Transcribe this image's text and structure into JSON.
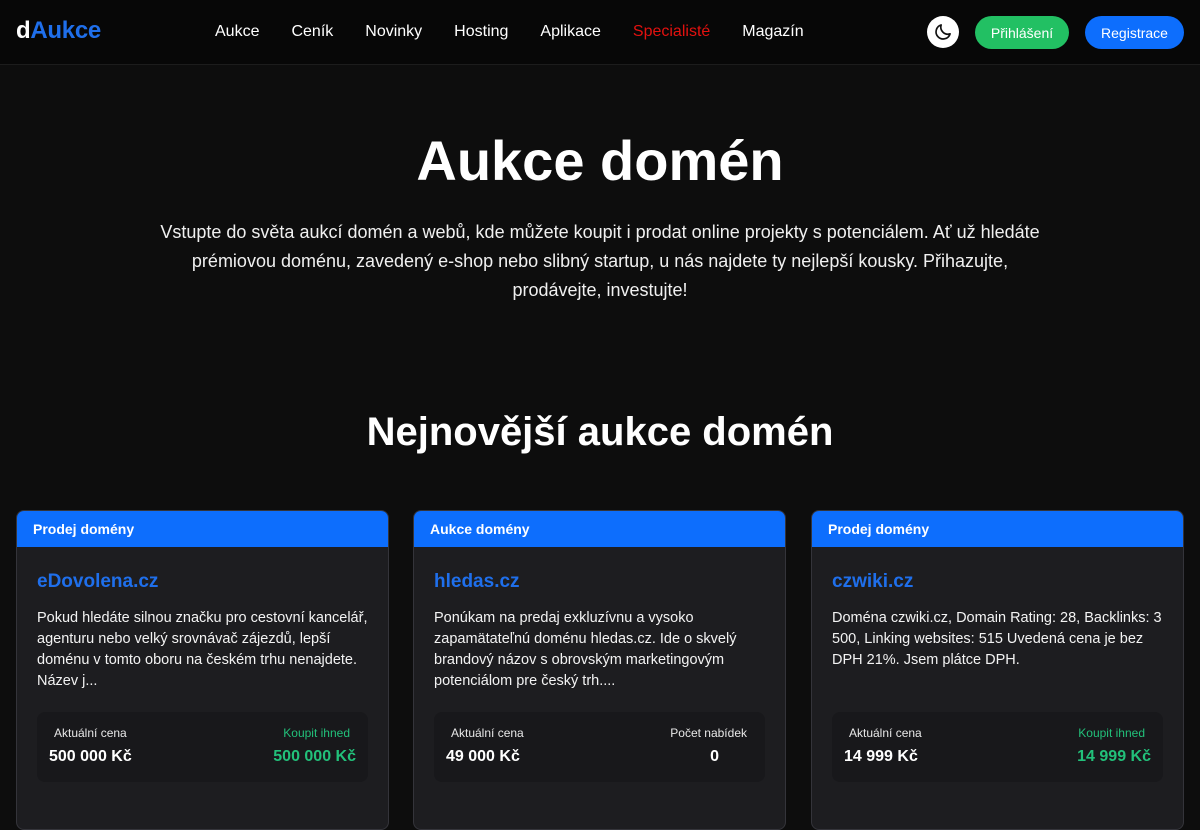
{
  "brand": {
    "part1": "d",
    "part2": "Aukce"
  },
  "nav": {
    "items": [
      {
        "label": "Aukce"
      },
      {
        "label": "Ceník"
      },
      {
        "label": "Novinky"
      },
      {
        "label": "Hosting"
      },
      {
        "label": "Aplikace"
      },
      {
        "label": "Specialisté"
      },
      {
        "label": "Magazín"
      }
    ],
    "active_index": 5,
    "login_label": "Přihlášení",
    "register_label": "Registrace",
    "theme_icon": "moon-icon"
  },
  "hero": {
    "title": "Aukce domén",
    "text": "Vstupte do světa aukcí domén a webů, kde můžete koupit i prodat online projekty s potenciálem. Ať už hledáte prémiovou doménu, zavedený e-shop nebo slibný startup, u nás najdete ty nejlepší kousky. Přihazujte, prodávejte, investujte!"
  },
  "section": {
    "title": "Nejnovější aukce domén"
  },
  "cards": [
    {
      "category": "Prodej domény",
      "domain": "eDovolena.cz",
      "description": "Pokud hledáte silnou značku pro cestovní kancelář, agenturu nebo velký srovnávač zájezdů, lepší doménu v tomto oboru na českém trhu nenajdete. Název j...",
      "left_label": "Aktuální cena",
      "left_value": "500 000 Kč",
      "right_label": "Koupit ihned",
      "right_value": "500 000 Kč"
    },
    {
      "category": "Aukce domény",
      "domain": "hledas.cz",
      "description": "Ponúkam na predaj exkluzívnu a vysoko zapamätateľnú doménu hledas.cz. Ide o skvelý brandový názov s obrovským marketingovým potenciálom pre český trh....",
      "left_label": "Aktuální cena",
      "left_value": "49 000 Kč",
      "right_label": "Počet nabídek",
      "right_value": "0"
    },
    {
      "category": "Prodej domény",
      "domain": "czwiki.cz",
      "description": "Doména czwiki.cz, Domain Rating: 28, Backlinks: 3 500, Linking websites: 515 Uvedená cena je bez DPH 21%. Jsem plátce DPH.",
      "left_label": "Aktuální cena",
      "left_value": "14 999 Kč",
      "right_label": "Koupit ihned",
      "right_value": "14 999 Kč"
    }
  ],
  "colors": {
    "accent_blue": "#0d6efd",
    "accent_green": "#22c063",
    "price_green": "#22c07a",
    "active_red": "#e3110f",
    "background": "#0d0d0d"
  }
}
